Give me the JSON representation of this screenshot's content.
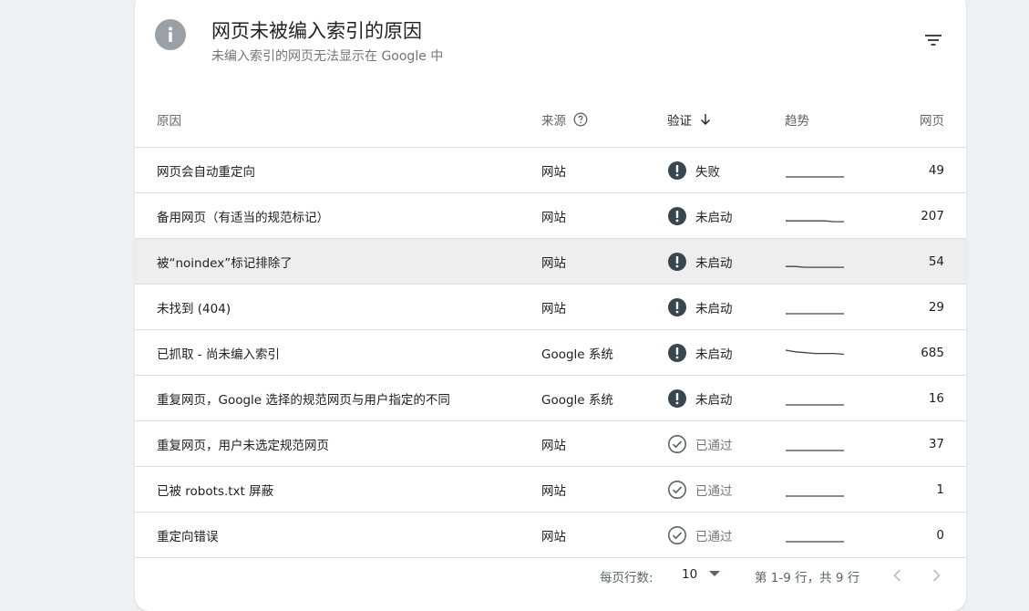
{
  "header": {
    "title": "网页未被编入索引的原因",
    "subtitle": "未编入索引的网页无法显示在 Google 中"
  },
  "columns": {
    "reason": "原因",
    "source": "来源",
    "verify": "验证",
    "trend": "趋势",
    "pages": "网页"
  },
  "rows": [
    {
      "reason": "网页会自动重定向",
      "source": "网站",
      "status": "失败",
      "status_type": "error",
      "trend": [
        1,
        1,
        1,
        1,
        1,
        1,
        1
      ],
      "pages": "49"
    },
    {
      "reason": "备用网页（有适当的规范标记）",
      "source": "网站",
      "status": "未启动",
      "status_type": "error",
      "trend": [
        3,
        3,
        3,
        3,
        3,
        2,
        2
      ],
      "pages": "207"
    },
    {
      "reason": "被“noindex”标记排除了",
      "source": "网站",
      "status": "未启动",
      "status_type": "error",
      "trend": [
        3,
        3,
        2,
        2,
        2,
        2,
        2
      ],
      "pages": "54"
    },
    {
      "reason": "未找到 (404)",
      "source": "网站",
      "status": "未启动",
      "status_type": "error",
      "trend": [
        1,
        1,
        1,
        1,
        1,
        1,
        1
      ],
      "pages": "29"
    },
    {
      "reason": "已抓取 - 尚未编入索引",
      "source": "Google 系统",
      "status": "未启动",
      "status_type": "error",
      "trend": [
        12,
        10,
        9,
        8,
        8,
        8,
        7
      ],
      "pages": "685"
    },
    {
      "reason": "重复网页，Google 选择的规范网页与用户指定的不同",
      "source": "Google 系统",
      "status": "未启动",
      "status_type": "error",
      "trend": [
        1,
        1,
        1,
        1,
        1,
        1,
        1
      ],
      "pages": "16"
    },
    {
      "reason": "重复网页，用户未选定规范网页",
      "source": "网站",
      "status": "已通过",
      "status_type": "passed",
      "trend": [
        1,
        1,
        1,
        1,
        1,
        1,
        1
      ],
      "pages": "37"
    },
    {
      "reason": "已被 robots.txt 屏蔽",
      "source": "网站",
      "status": "已通过",
      "status_type": "passed",
      "trend": [
        1,
        1,
        1,
        1,
        1,
        1,
        1
      ],
      "pages": "1"
    },
    {
      "reason": "重定向错误",
      "source": "网站",
      "status": "已通过",
      "status_type": "passed",
      "trend": [
        1,
        1,
        1,
        1,
        1,
        1,
        1
      ],
      "pages": "0"
    }
  ],
  "pagination": {
    "rows_per_page_label": "每页行数:",
    "rows_per_page_value": "10",
    "range_text": "第 1-9 行，共 9 行"
  },
  "colors": {
    "error_icon": "#37474f",
    "passed_icon": "#5f6368",
    "info_icon": "#9aa0a6",
    "sparkline": "#37474f"
  },
  "icons": {
    "header": "info-icon",
    "filter": "filter-icon",
    "source_help": "help-circle-icon",
    "sort": "arrow-down-icon",
    "error": "error-icon",
    "passed": "check-circle-icon"
  }
}
